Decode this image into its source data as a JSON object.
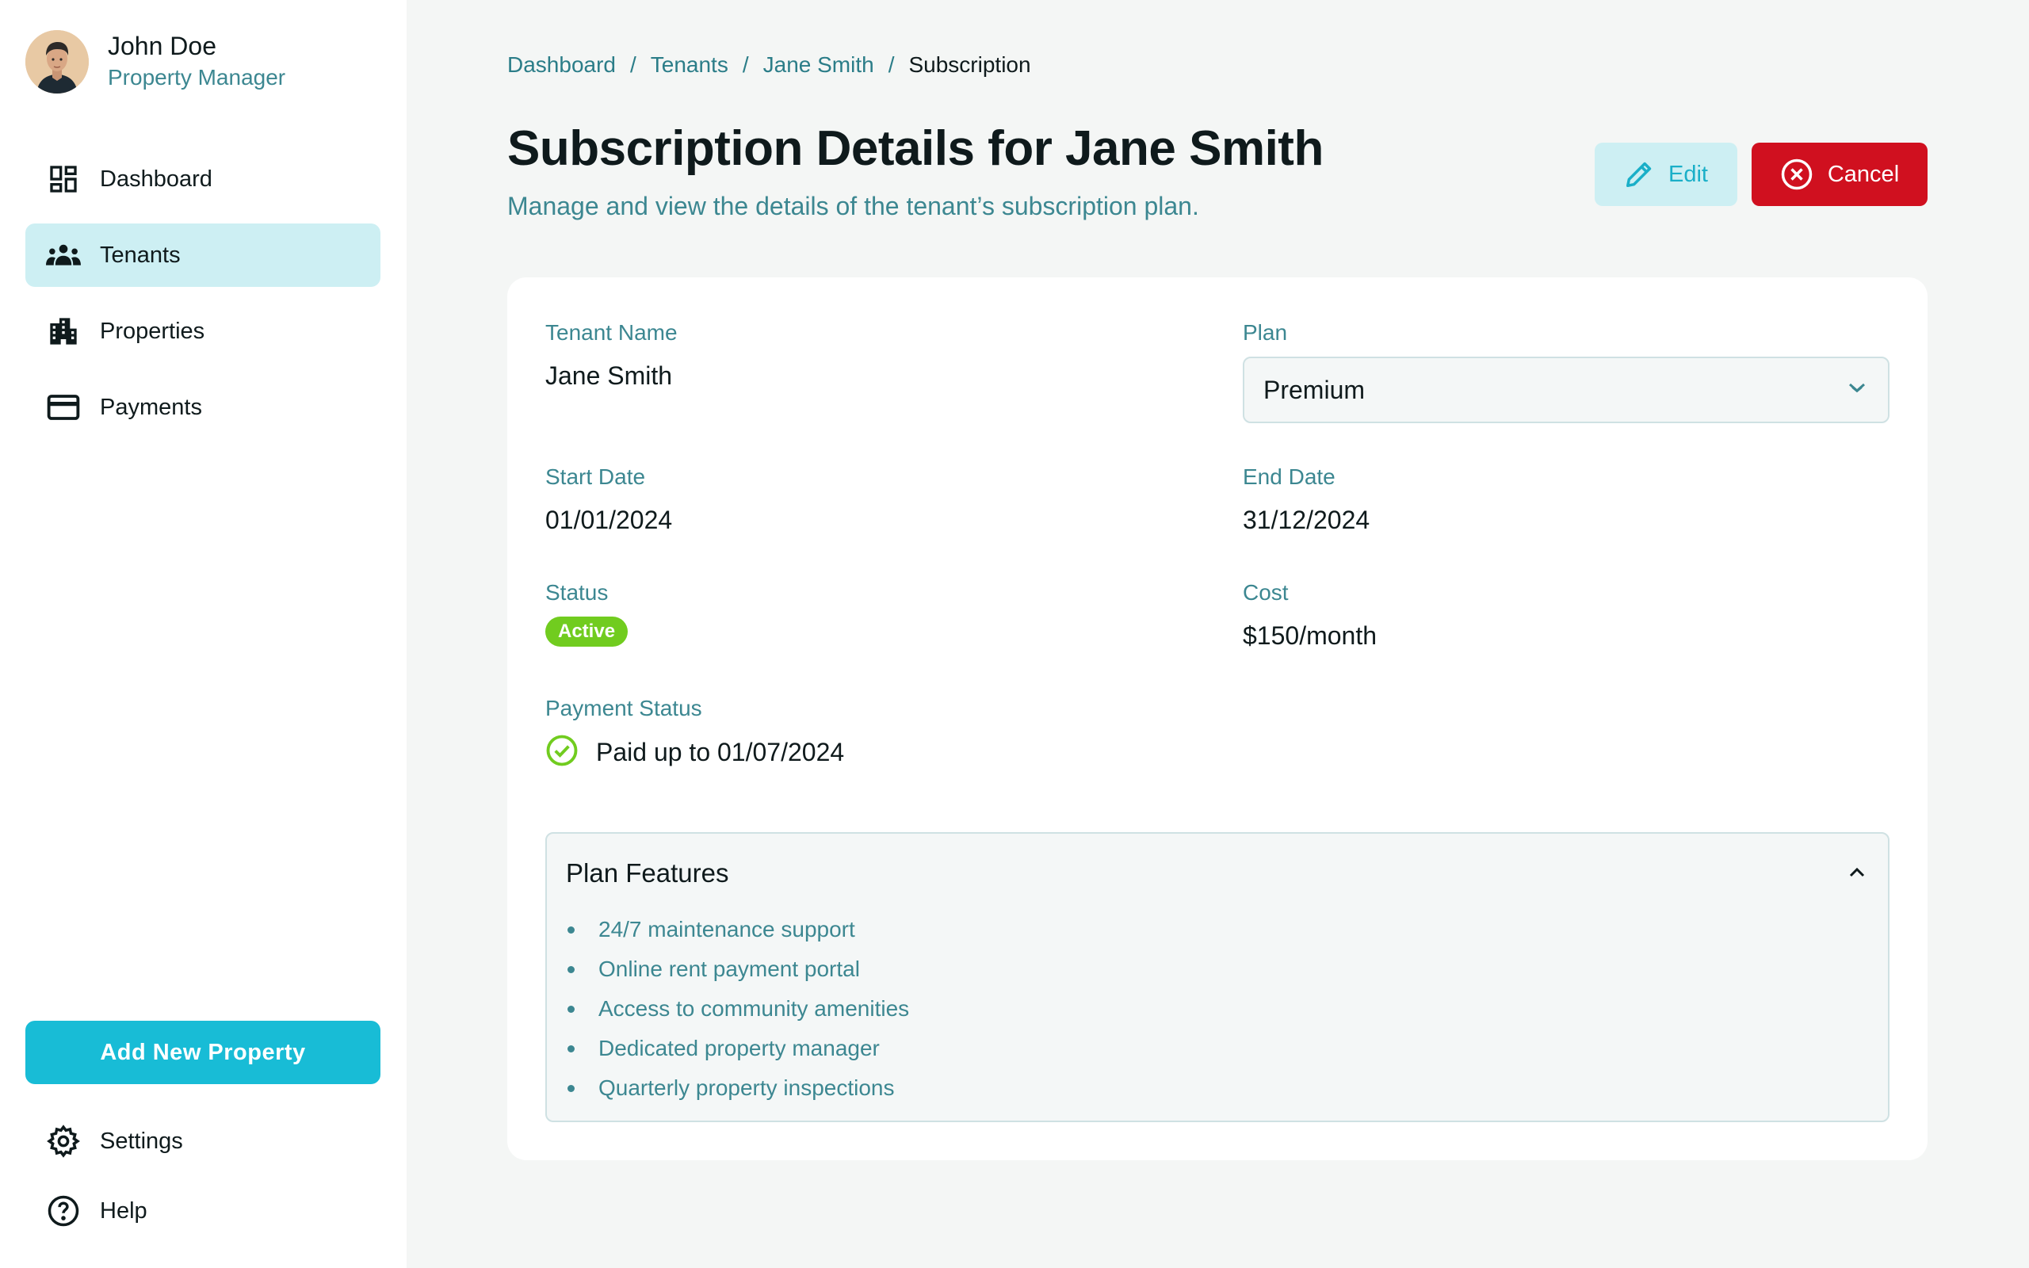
{
  "user": {
    "name": "John Doe",
    "role": "Property Manager"
  },
  "sidebar": {
    "items": [
      {
        "label": "Dashboard",
        "icon": "dashboard-icon"
      },
      {
        "label": "Tenants",
        "icon": "group-icon",
        "active": true
      },
      {
        "label": "Properties",
        "icon": "building-icon"
      },
      {
        "label": "Payments",
        "icon": "credit-card-icon"
      }
    ],
    "add_button": "Add New Property",
    "bottom_items": [
      {
        "label": "Settings",
        "icon": "gear-icon"
      },
      {
        "label": "Help",
        "icon": "help-icon"
      }
    ]
  },
  "breadcrumb": {
    "items": [
      "Dashboard",
      "Tenants",
      "Jane Smith"
    ],
    "current": "Subscription",
    "separator": "/"
  },
  "page": {
    "title": "Subscription Details for Jane Smith",
    "subtitle": "Manage and view the details of the tenant’s subscription plan."
  },
  "actions": {
    "edit": "Edit",
    "cancel": "Cancel"
  },
  "subscription": {
    "tenant_name_label": "Tenant Name",
    "tenant_name": "Jane Smith",
    "plan_label": "Plan",
    "plan": "Premium",
    "start_date_label": "Start Date",
    "start_date": "01/01/2024",
    "end_date_label": "End Date",
    "end_date": "31/12/2024",
    "status_label": "Status",
    "status": "Active",
    "cost_label": "Cost",
    "cost": "$150/month",
    "payment_status_label": "Payment Status",
    "payment_status": "Paid up to 01/07/2024"
  },
  "features": {
    "title": "Plan Features",
    "expanded": true,
    "items": [
      "24/7 maintenance support",
      "Online rent payment portal",
      "Access to community amenities",
      "Dedicated property manager",
      "Quarterly property inspections"
    ]
  },
  "colors": {
    "accent": "#18bcd6",
    "accent_light": "#cdeff3",
    "danger": "#d0101f",
    "success": "#71cc1f",
    "muted_text": "#3c8791",
    "background": "#f4f6f5"
  }
}
